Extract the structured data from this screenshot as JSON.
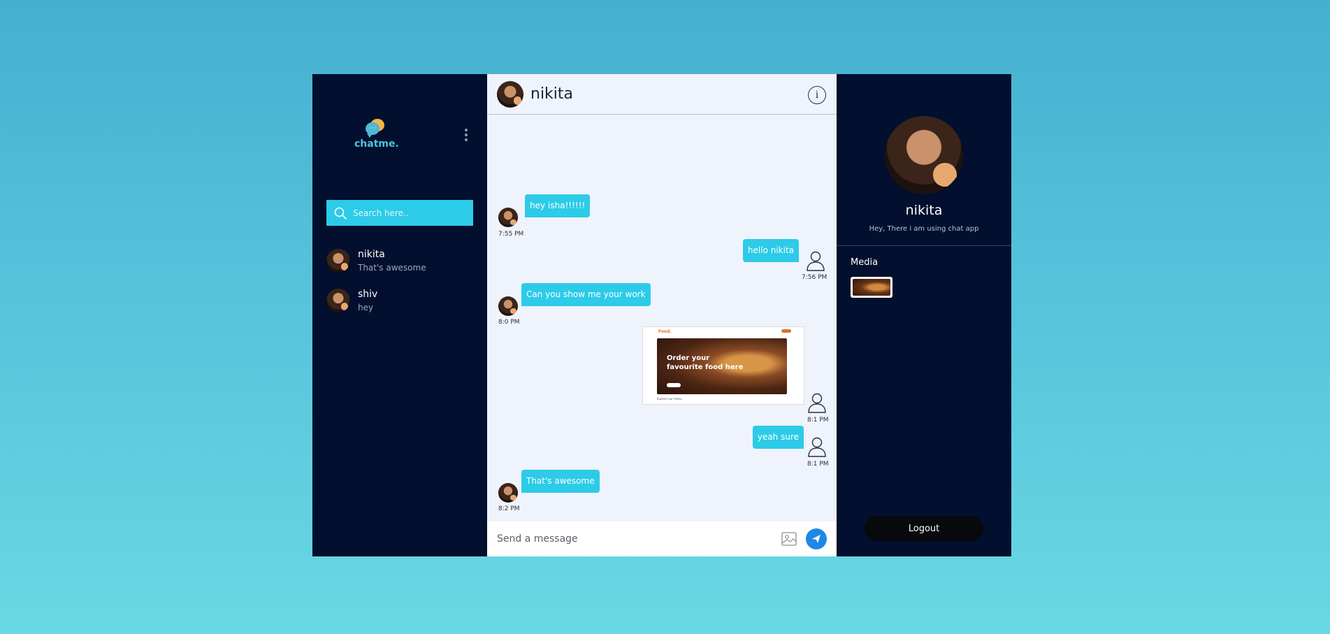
{
  "brand": {
    "name": "chatme.",
    "icon": "chat-bubbles-logo"
  },
  "sidebar": {
    "menu_icon": "kebab-menu-icon",
    "search": {
      "placeholder": "Search here..",
      "value": ""
    },
    "contacts": [
      {
        "name": "nikita",
        "last_message": "That's awesome"
      },
      {
        "name": "shiv",
        "last_message": "hey"
      }
    ]
  },
  "chat": {
    "contact_name": "nikita",
    "info_icon": "info-icon",
    "messages": [
      {
        "direction": "in",
        "text": "hey isha!!!!!!",
        "time": "7:55 PM"
      },
      {
        "direction": "out",
        "text": "hello nikita",
        "time": "7:56 PM"
      },
      {
        "direction": "in",
        "text": "Can you show me your work",
        "time": "8:0 PM"
      },
      {
        "direction": "out",
        "type": "image",
        "image_text": "Order your favourite food here",
        "time": "8:1 PM"
      },
      {
        "direction": "out",
        "text": "yeah sure",
        "time": "8:1 PM"
      },
      {
        "direction": "in",
        "text": "That's awesome",
        "time": "8:2 PM"
      }
    ],
    "composer": {
      "placeholder": "Send a message",
      "value": ""
    }
  },
  "profile": {
    "name": "nikita",
    "status": "Hey, There i am using chat app",
    "media_label": "Media",
    "logout_label": "Logout"
  },
  "colors": {
    "background_top": "#45b0d0",
    "panel_dark": "#020f2e",
    "chat_bg": "#eff3fb",
    "bubble": "#2ccbe8",
    "send_button": "#1e88e5"
  }
}
